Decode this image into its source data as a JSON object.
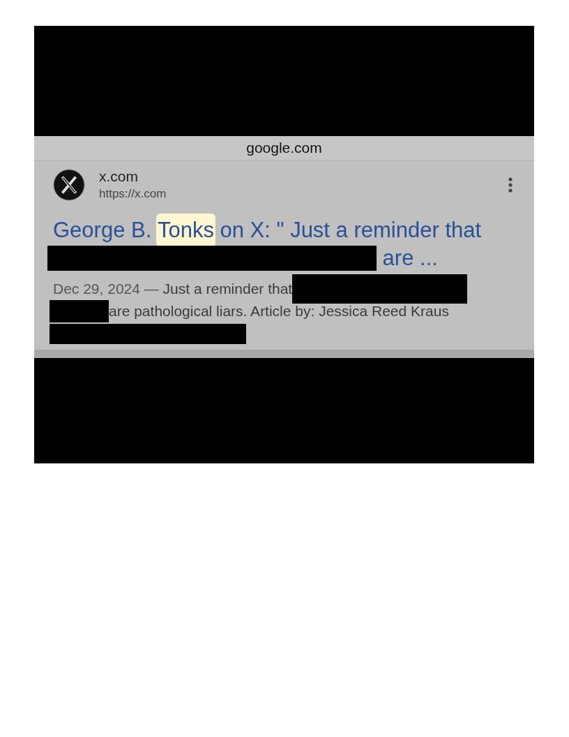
{
  "address_bar": {
    "domain": "google.com"
  },
  "result": {
    "site_name": "x.com",
    "url": "https://x.com",
    "title_lines": [
      [
        {
          "kind": "text",
          "text": "George B. "
        },
        {
          "kind": "highlight",
          "text": "Tonks"
        },
        {
          "kind": "text",
          "text": " on X: \" Just a reminder that"
        }
      ],
      [
        {
          "kind": "redaction"
        },
        {
          "kind": "text",
          "text": " are ..."
        }
      ]
    ],
    "snippet_lines": [
      [
        {
          "kind": "date",
          "text": "Dec 29, 2024 — "
        },
        {
          "kind": "text",
          "text": "Just a reminder that"
        },
        {
          "kind": "redaction"
        }
      ],
      [
        {
          "kind": "redaction"
        },
        {
          "kind": "text",
          "text": "are pathological liars. Article by: Jessica Reed Kraus"
        }
      ],
      [
        {
          "kind": "redaction"
        }
      ]
    ]
  }
}
